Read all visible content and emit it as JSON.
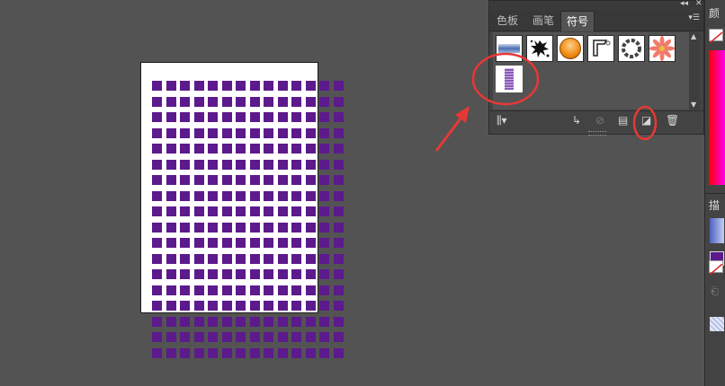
{
  "window": {
    "top_icons": [
      "collapse-icon",
      "close-icon"
    ]
  },
  "symbols_panel": {
    "tabs": [
      {
        "label": "色板",
        "active": false
      },
      {
        "label": "画笔",
        "active": false
      },
      {
        "label": "符号",
        "active": true
      }
    ],
    "symbols": [
      {
        "name": "blue-gradient-bar-symbol"
      },
      {
        "name": "ink-splat-symbol"
      },
      {
        "name": "orange-button-symbol"
      },
      {
        "name": "tag-frame-symbol"
      },
      {
        "name": "chain-ring-symbol"
      },
      {
        "name": "flower-symbol"
      },
      {
        "name": "purple-grid-symbol",
        "selected": true
      }
    ],
    "toolbar_icons": [
      "symbol-library-icon",
      "place-symbol-icon",
      "break-link-icon",
      "symbol-options-icon",
      "new-symbol-icon",
      "delete-symbol-icon"
    ]
  },
  "right_panel": {
    "color_label": "颜",
    "stroke_label": "描"
  },
  "artwork": {
    "fill_color": "#5c1a8c",
    "rows": 18,
    "cols": 14
  },
  "annotations": {
    "color": "#e53935"
  }
}
